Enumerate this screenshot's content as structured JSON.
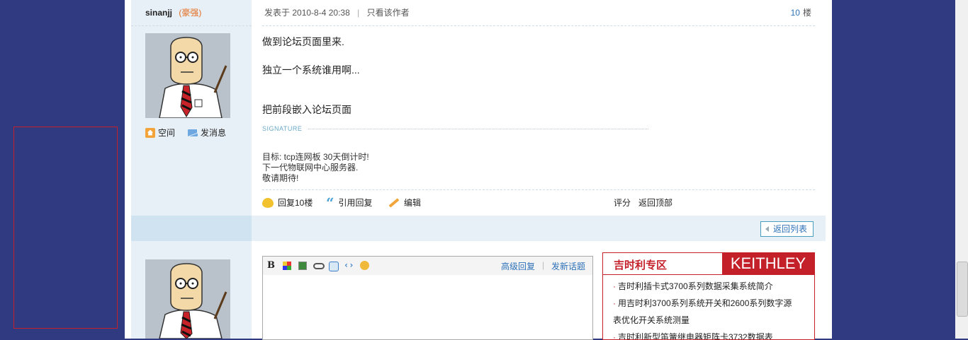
{
  "post": {
    "author": {
      "name": "sinanjj",
      "rank": "(豪强)"
    },
    "meta": {
      "posted_label": "发表于",
      "date": "2010-8-4 20:38",
      "separator": "|",
      "only_author": "只看该作者"
    },
    "floor": {
      "number": "10",
      "suffix": "楼"
    },
    "profile_links": {
      "space": "空间",
      "message": "发消息"
    },
    "content": [
      "做到论坛页面里来.",
      "独立一个系统谁用啊...",
      "把前段嵌入论坛页面"
    ],
    "signature": {
      "label": "SIGNATURE",
      "lines": [
        "目标: tcp连网板 30天倒计时!",
        "下一代物联网中心服务器.",
        "敬请期待!"
      ]
    },
    "actions": {
      "reply": "回复10楼",
      "quote": "引用回复",
      "edit": "编辑",
      "rate": "评分",
      "back_top": "返回顶部"
    }
  },
  "back_to_list": "返回列表",
  "editor": {
    "toolbar_icons": [
      "bold-icon",
      "color-icon",
      "image-icon",
      "link-icon",
      "quote-icon",
      "code-icon",
      "smiley-icon"
    ],
    "bold_glyph": "B",
    "code_glyph": "‹›",
    "advanced_reply": "高级回复",
    "separator": "|",
    "new_topic": "发新话题"
  },
  "ad": {
    "title": "吉时利专区",
    "logo": "KEITHLEY",
    "items": [
      "吉时利插卡式3700系列数据采集系统简介",
      "用吉时利3700系列系统开关和2600系列数字源",
      "表优化开关系统测量",
      "吉时利新型笛簧继电器矩阵卡3732数据表"
    ],
    "bullet": "·"
  },
  "colors": {
    "background": "#2f3a80",
    "accent": "#c4202a",
    "link": "#2d71b8",
    "rank": "#e36c1f"
  }
}
